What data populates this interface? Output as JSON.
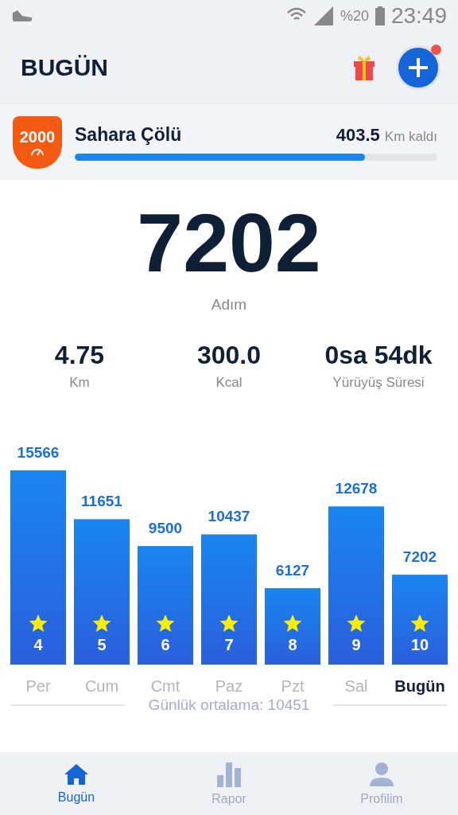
{
  "status_bar": {
    "battery": "%20",
    "time": "23:49"
  },
  "header": {
    "title": "BUGÜN",
    "notification": true
  },
  "challenge": {
    "badge": "2000",
    "name": "Sahara Çölü",
    "remaining": "403.5",
    "remaining_unit": "Km kaldı",
    "level": 0.8
  },
  "today": {
    "steps": "7202",
    "steps_label": "Adım"
  },
  "stats": [
    {
      "value": "4.75",
      "label": "Km"
    },
    {
      "value": "300.0",
      "label": "Kcal"
    },
    {
      "value": "0sa 54dk",
      "label": "Yürüyüş Süresi"
    }
  ],
  "week": {
    "bars": [
      {
        "badge": "4",
        "selected": false
      },
      {
        "badge": "5",
        "selected": false
      },
      {
        "badge": "6",
        "selected": false
      },
      {
        "badge": "7",
        "selected": false
      },
      {
        "badge": "8",
        "selected": false
      },
      {
        "badge": "9",
        "selected": false
      },
      {
        "badge": "10",
        "selected": true
      }
    ],
    "chart_data": {
      "type": "bar",
      "categories": [
        "Per",
        "Cum",
        "Cmt",
        "Paz",
        "Pzt",
        "Sal",
        "Bugün"
      ],
      "values": [
        15566,
        11651,
        9500,
        10437,
        6127,
        12678,
        7202
      ],
      "data_labels": true
    },
    "average": "Günlük ortalama: 10451"
  },
  "tab_bar": [
    {
      "label": "Bugün",
      "kind": "home",
      "selected": true
    },
    {
      "label": "Rapor",
      "kind": "report",
      "selected": false
    },
    {
      "label": "Profilim",
      "kind": "profile",
      "selected": false
    }
  ]
}
